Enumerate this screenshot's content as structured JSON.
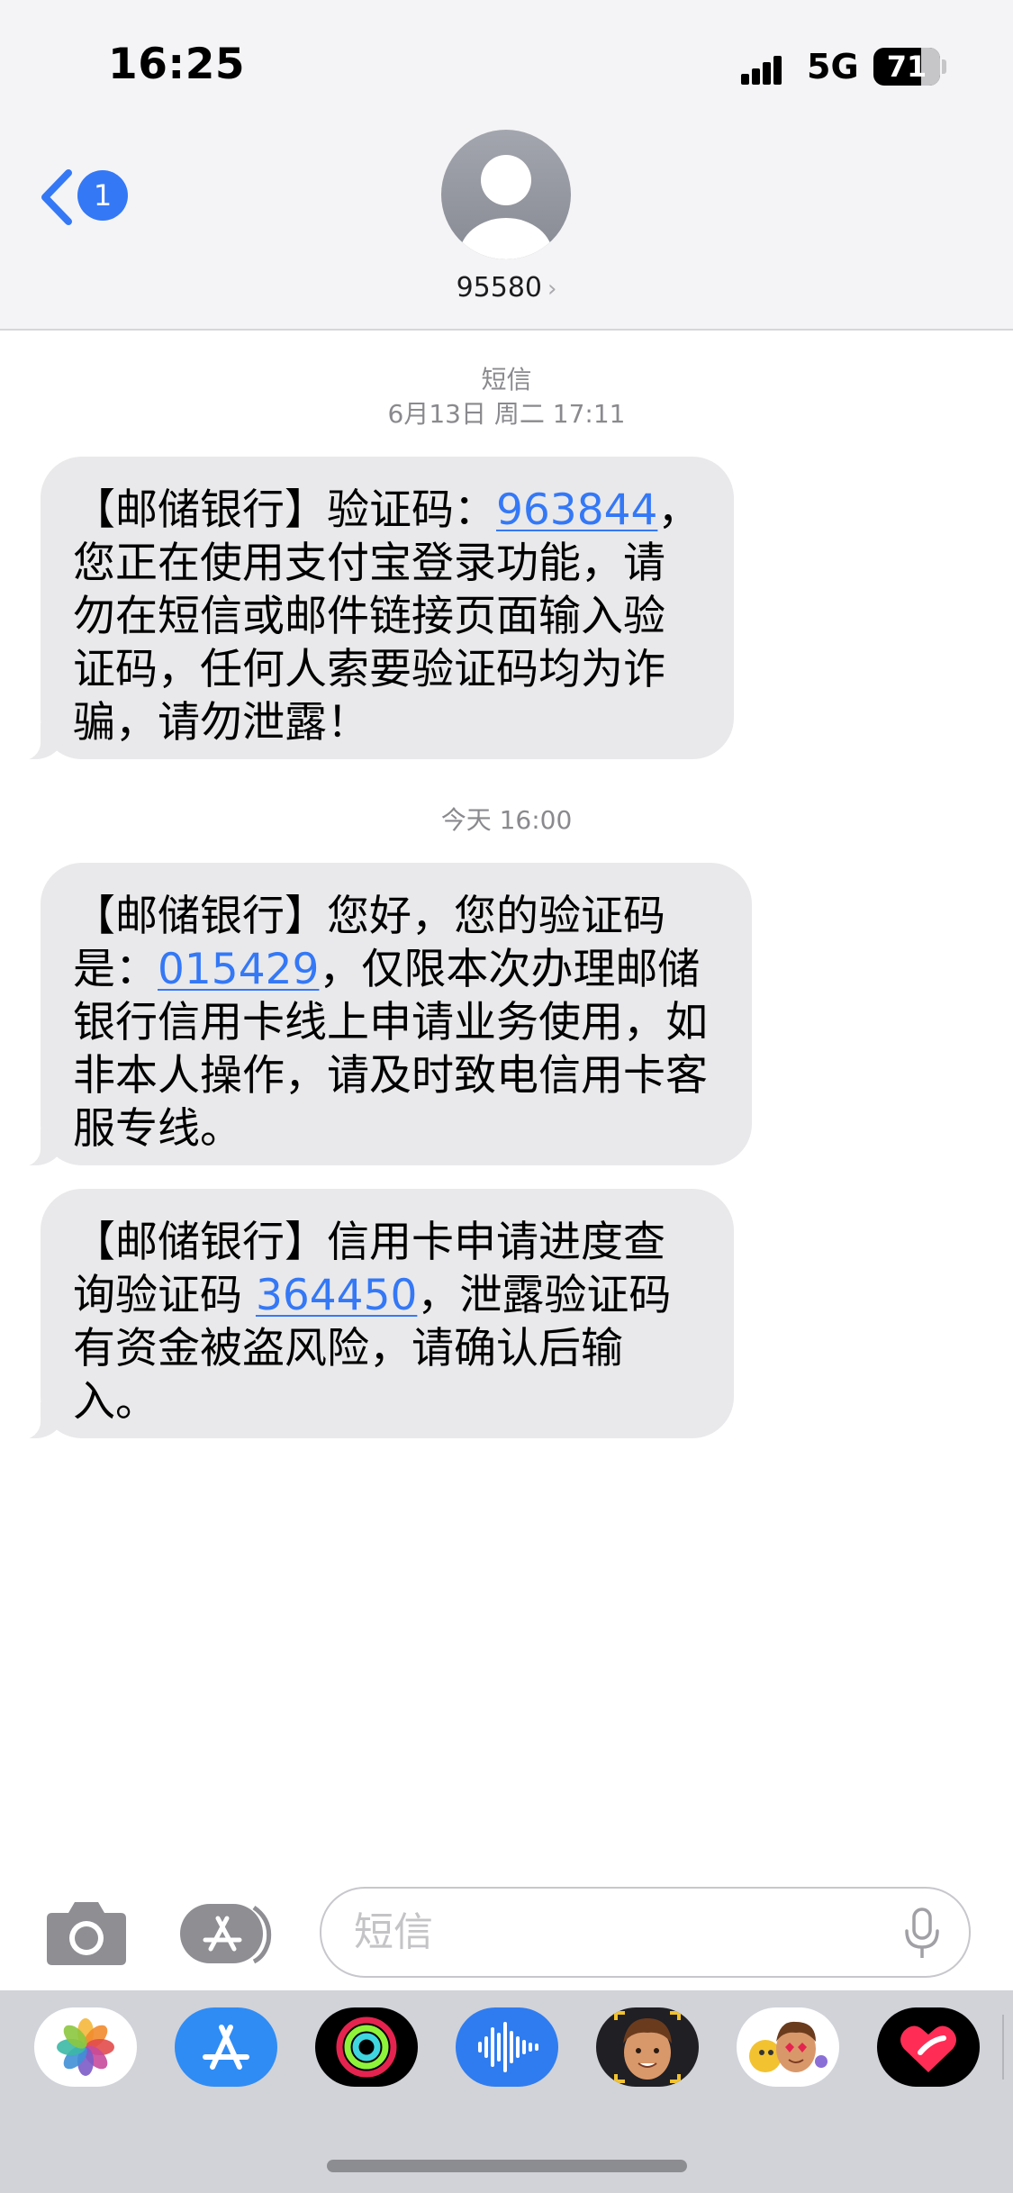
{
  "status_bar": {
    "time": "16:25",
    "network": "5G",
    "battery_level": "71",
    "battery_percent": 71
  },
  "header": {
    "back_badge": "1",
    "contact_number": "95580",
    "contact_chevron": "›"
  },
  "thread": {
    "service_label": "短信",
    "first_timestamp": "6月13日 周二 17:11",
    "second_timestamp": "今天 16:00"
  },
  "messages": [
    {
      "before": "【邮储银行】验证码：",
      "code": "963844",
      "after": "，您正在使用支付宝登录功能，请勿在短信或邮件链接页面输入验证码，任何人索要验证码均为诈骗，请勿泄露！"
    },
    {
      "before": "【邮储银行】您好，您的验证码是：",
      "code": "015429",
      "after": "，仅限本次办理邮储银行信用卡线上申请业务使用，如非本人操作，请及时致电信用卡客服专线。"
    },
    {
      "before": "【邮储银行】信用卡申请进度查询验证码 ",
      "code": "364450",
      "after": "，泄露验证码有资金被盗风险，请确认后输入。"
    }
  ],
  "composer": {
    "placeholder": "短信",
    "value": ""
  },
  "app_drawer": {
    "items": [
      "photos-icon",
      "app-store-icon",
      "fitness-icon",
      "audio-message-icon",
      "memoji-icon",
      "memoji-stickers-icon",
      "digital-touch-icon"
    ]
  },
  "colors": {
    "accent": "#3478f6",
    "bubble": "#e9e9eb",
    "header_bg": "#f4f4f6",
    "drawer_bg": "#d1d3d9"
  }
}
